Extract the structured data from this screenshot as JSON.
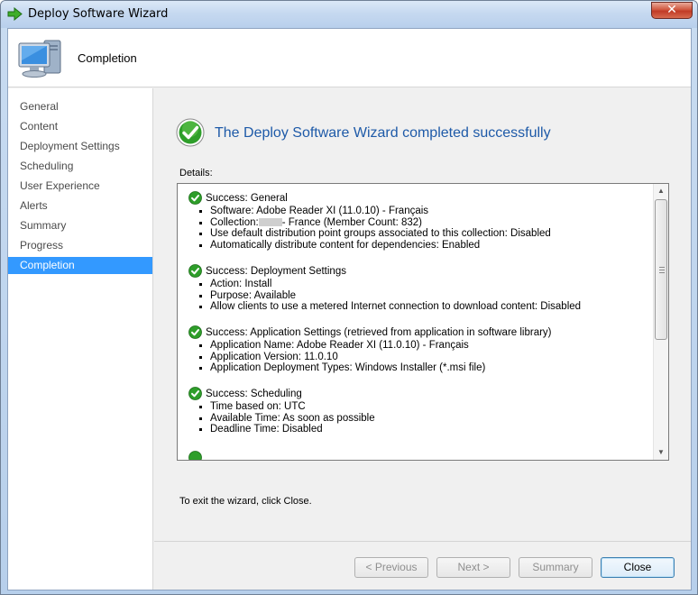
{
  "window": {
    "title": "Deploy Software Wizard",
    "close_label": "✕"
  },
  "header": {
    "title": "Completion"
  },
  "nav": {
    "items": [
      {
        "label": "General"
      },
      {
        "label": "Content"
      },
      {
        "label": "Deployment Settings"
      },
      {
        "label": "Scheduling"
      },
      {
        "label": "User Experience"
      },
      {
        "label": "Alerts"
      },
      {
        "label": "Summary"
      },
      {
        "label": "Progress"
      },
      {
        "label": "Completion",
        "active": true
      }
    ]
  },
  "main": {
    "heading": "The Deploy Software Wizard completed successfully",
    "details_label": "Details:",
    "sections": [
      {
        "title": "Success: General",
        "items": [
          "Software: Adobe Reader XI (11.0.10) - Français",
          "Collection:",
          "- France (Member Count: 832)",
          "Use default distribution point groups associated to this collection: Disabled",
          "Automatically distribute content for dependencies: Enabled"
        ]
      },
      {
        "title": "Success: Deployment Settings",
        "items": [
          "Action: Install",
          "Purpose: Available",
          "Allow clients to use a metered Internet connection to download content: Disabled"
        ]
      },
      {
        "title": "Success: Application Settings (retrieved from application in software library)",
        "items": [
          "Application Name: Adobe Reader XI (11.0.10) - Français",
          "Application Version: 11.0.10",
          "Application Deployment Types: Windows Installer (*.msi file)"
        ]
      },
      {
        "title": "Success: Scheduling",
        "items": [
          "Time based on: UTC",
          "Available Time: As soon as possible",
          "Deadline Time: Disabled"
        ]
      }
    ],
    "exit_text": "To exit the wizard, click Close."
  },
  "buttons": {
    "previous": "< Previous",
    "next": "Next >",
    "summary": "Summary",
    "close": "Close"
  },
  "colors": {
    "accent": "#3399ff",
    "heading": "#1e5aa8",
    "success": "#2c9a2c"
  }
}
